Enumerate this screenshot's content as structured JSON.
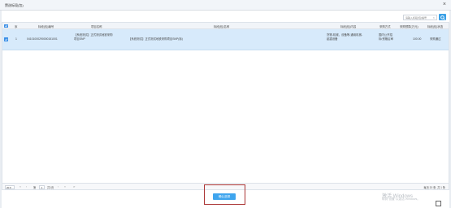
{
  "dialog": {
    "title": "赞选标段(包)",
    "close": "×"
  },
  "toolbar": {
    "search_placeholder": "请输入标段(包)编号",
    "clear_glyph": "×"
  },
  "table": {
    "columns": [
      "序",
      "标段(包)编号",
      "项目名称",
      "标段(包)名称",
      "标段(包)内容",
      "采购方式",
      "采购预算(万元)",
      "标段(包)状态"
    ],
    "rows": [
      {
        "index": "1",
        "code": "04101000290000151001",
        "project_name": "【系统测试】正式测试地铁采购项目SNP",
        "package_name_prefix": "【系统测试】正式测试地铁采购项目SNP",
        "package_name_suffix": "(标)",
        "content": "货物-机械、设备等-通用机械-起重设备",
        "method": "国内公开招标/资格后审",
        "budget": "100.00",
        "status": "采购通过"
      }
    ]
  },
  "pager": {
    "page_size": "20",
    "first": "«",
    "prev": "‹",
    "page_label": "第",
    "current_page": "1",
    "total_pages": "共1页",
    "next": "›",
    "last": "»",
    "refresh": "⟳",
    "summary": "每页 20 条, 共 1 条"
  },
  "footer": {
    "confirm": "确认选择"
  },
  "watermark": {
    "line1": "激活 Windows",
    "line2": "转到\"设置\"以激活 Windows。"
  },
  "colors": {
    "accent": "#3a8ee6",
    "selected_row": "#d7eafb",
    "highlight_border": "#a33"
  }
}
